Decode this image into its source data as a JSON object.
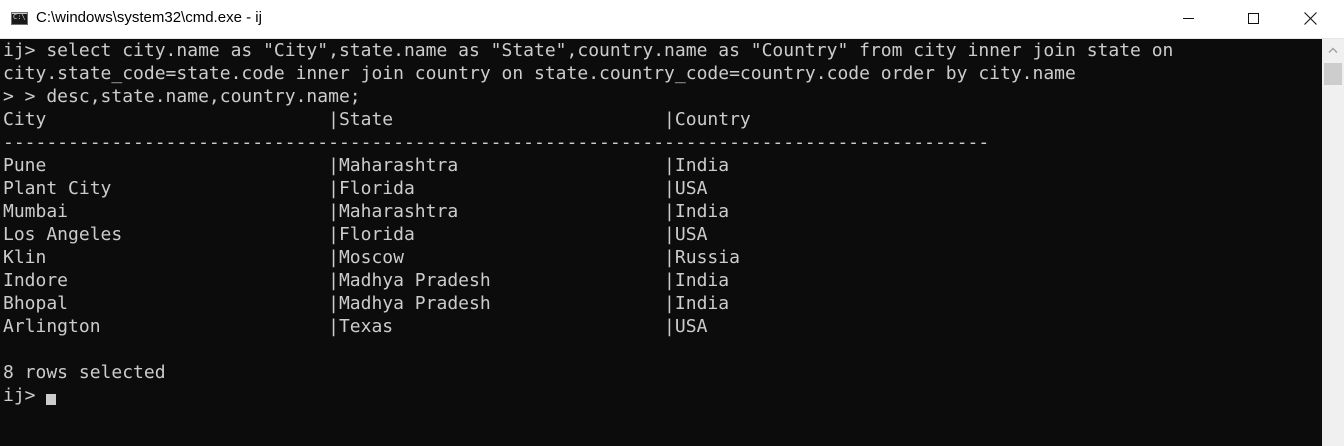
{
  "window": {
    "icon_label": "C:\\",
    "title": "C:\\windows\\system32\\cmd.exe - ij"
  },
  "console": {
    "lines": [
      "ij> select city.name as \"City\",state.name as \"State\",country.name as \"Country\" from city inner join state on",
      "city.state_code=state.code inner join country on state.country_code=country.code order by city.name",
      "> > desc,state.name,country.name;",
      "City                          |State                         |Country",
      "-------------------------------------------------------------------------------------------",
      "Pune                          |Maharashtra                   |India",
      "Plant City                    |Florida                       |USA",
      "Mumbai                        |Maharashtra                   |India",
      "Los Angeles                   |Florida                       |USA",
      "Klin                          |Moscow                        |Russia",
      "Indore                        |Madhya Pradesh                |India",
      "Bhopal                        |Madhya Pradesh                |India",
      "Arlington                     |Texas                         |USA",
      "",
      "8 rows selected",
      "ij> "
    ]
  },
  "colors": {
    "console_background": "#0c0c0c",
    "console_text": "#cccccc",
    "titlebar_background": "#ffffff"
  },
  "icons": {
    "app": "cmd-icon",
    "minimize": "minimize-icon",
    "maximize": "maximize-icon",
    "close": "close-icon",
    "scroll_up": "scroll-up-arrow-icon"
  }
}
